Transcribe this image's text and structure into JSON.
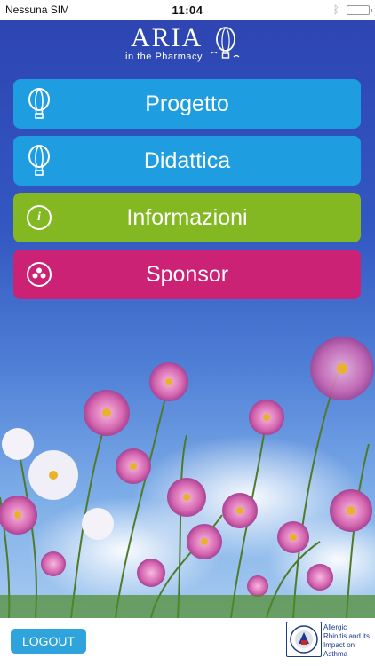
{
  "status_bar": {
    "carrier": "Nessuna SIM",
    "time": "11:04"
  },
  "logo": {
    "title": "ARIA",
    "subtitle": "in the Pharmacy"
  },
  "menu": [
    {
      "label": "Progetto",
      "icon": "balloon-icon",
      "color": "#1e9ee0"
    },
    {
      "label": "Didattica",
      "icon": "balloon-icon",
      "color": "#1e9ee0"
    },
    {
      "label": "Informazioni",
      "icon": "info-icon",
      "color": "#84b823"
    },
    {
      "label": "Sponsor",
      "icon": "sponsor-icon",
      "color": "#cc2276"
    }
  ],
  "footer": {
    "logout_label": "LOGOUT",
    "aria_lines": [
      "Allergic",
      "Rhinitis and its",
      "Impact on",
      "Asthma"
    ]
  }
}
